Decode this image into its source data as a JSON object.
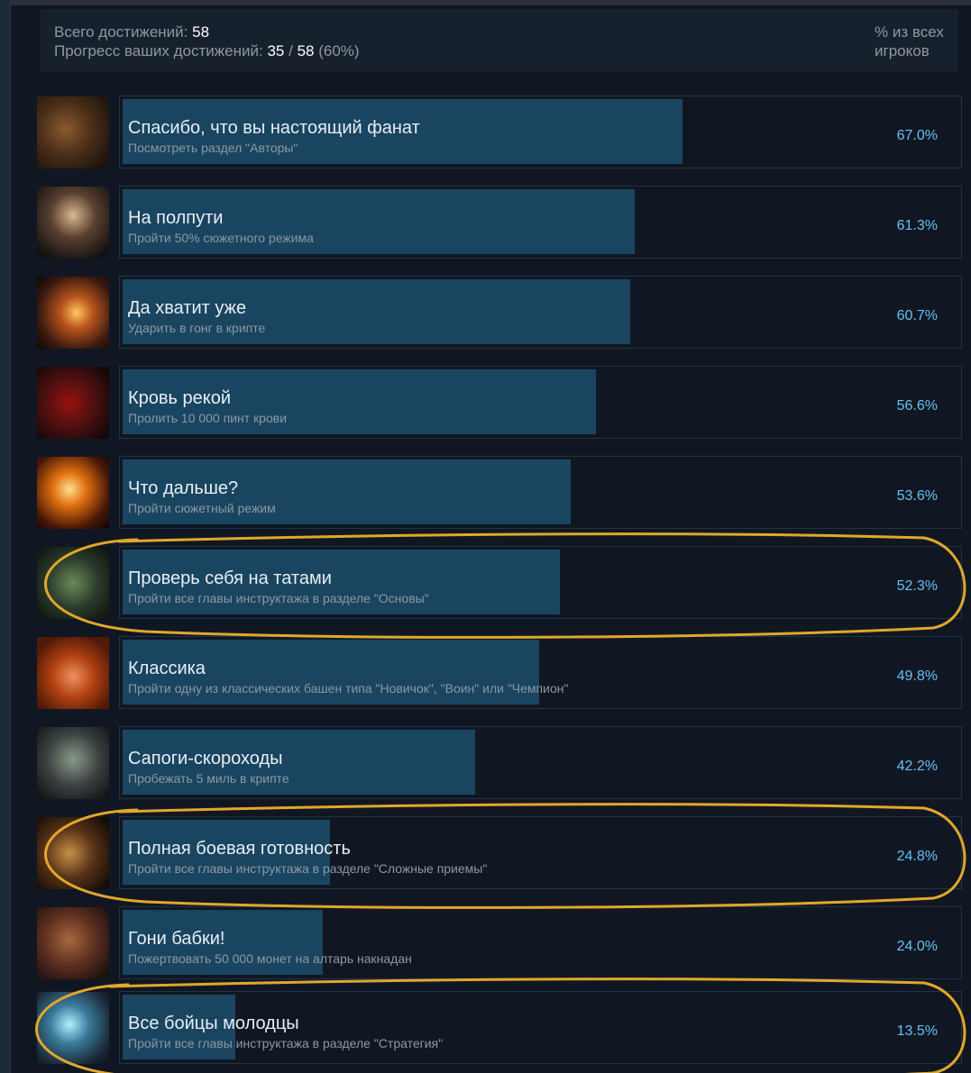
{
  "summary": {
    "total_label": "Всего достижений:",
    "total_value": "58",
    "progress_label": "Прогресс ваших достижений:",
    "progress_unlocked": "35",
    "progress_separator": "/",
    "progress_total": "58",
    "progress_percent": "(60%)",
    "column_header_line1": "% из всех",
    "column_header_line2": "игроков"
  },
  "colors": {
    "background": "#1b2838",
    "bar": "#1a4560",
    "percent_text": "#66c0f4",
    "highlight_circle": "#e1a72c"
  },
  "achievements": [
    {
      "title": "Спасибо, что вы настоящий фанат",
      "description": "Посмотреть раздел \"Авторы\"",
      "percent": "67.0%",
      "percent_value": 67.0,
      "icon": "fan-achievement-icon"
    },
    {
      "title": "На полпути",
      "description": "Пройти 50% сюжетного режима",
      "percent": "61.3%",
      "percent_value": 61.3,
      "icon": "halfway-achievement-icon"
    },
    {
      "title": "Да хватит уже",
      "description": "Ударить в гонг в крипте",
      "percent": "60.7%",
      "percent_value": 60.7,
      "icon": "gong-achievement-icon"
    },
    {
      "title": "Кровь рекой",
      "description": "Пролить 10 000 пинт крови",
      "percent": "56.6%",
      "percent_value": 56.6,
      "icon": "blood-achievement-icon"
    },
    {
      "title": "Что дальше?",
      "description": "Пройти сюжетный режим",
      "percent": "53.6%",
      "percent_value": 53.6,
      "icon": "story-complete-achievement-icon"
    },
    {
      "title": "Проверь себя на татами",
      "description": "Пройти все главы инструктажа в разделе \"Основы\"",
      "percent": "52.3%",
      "percent_value": 52.3,
      "icon": "tatami-achievement-icon",
      "highlighted": true
    },
    {
      "title": "Классика",
      "description": "Пройти одну из классических башен типа \"Новичок\", \"Воин\" или \"Чемпион\"",
      "percent": "49.8%",
      "percent_value": 49.8,
      "icon": "classic-tower-achievement-icon"
    },
    {
      "title": "Сапоги-скороходы",
      "description": "Пробежать 5 миль в крипте",
      "percent": "42.2%",
      "percent_value": 42.2,
      "icon": "boots-achievement-icon"
    },
    {
      "title": "Полная боевая готовность",
      "description": "Пройти все главы инструктажа в разделе \"Сложные приемы\"",
      "percent": "24.8%",
      "percent_value": 24.8,
      "icon": "combat-ready-achievement-icon",
      "highlighted": true
    },
    {
      "title": "Гони бабки!",
      "description": "Пожертвовать 50 000 монет на алтарь накнадан",
      "percent": "24.0%",
      "percent_value": 24.0,
      "icon": "money-achievement-icon"
    },
    {
      "title": "Все бойцы молодцы",
      "description": "Пройти все главы инструктажа в разделе \"Стратегия\"",
      "percent": "13.5%",
      "percent_value": 13.5,
      "icon": "strategy-achievement-icon",
      "highlighted": true
    }
  ]
}
